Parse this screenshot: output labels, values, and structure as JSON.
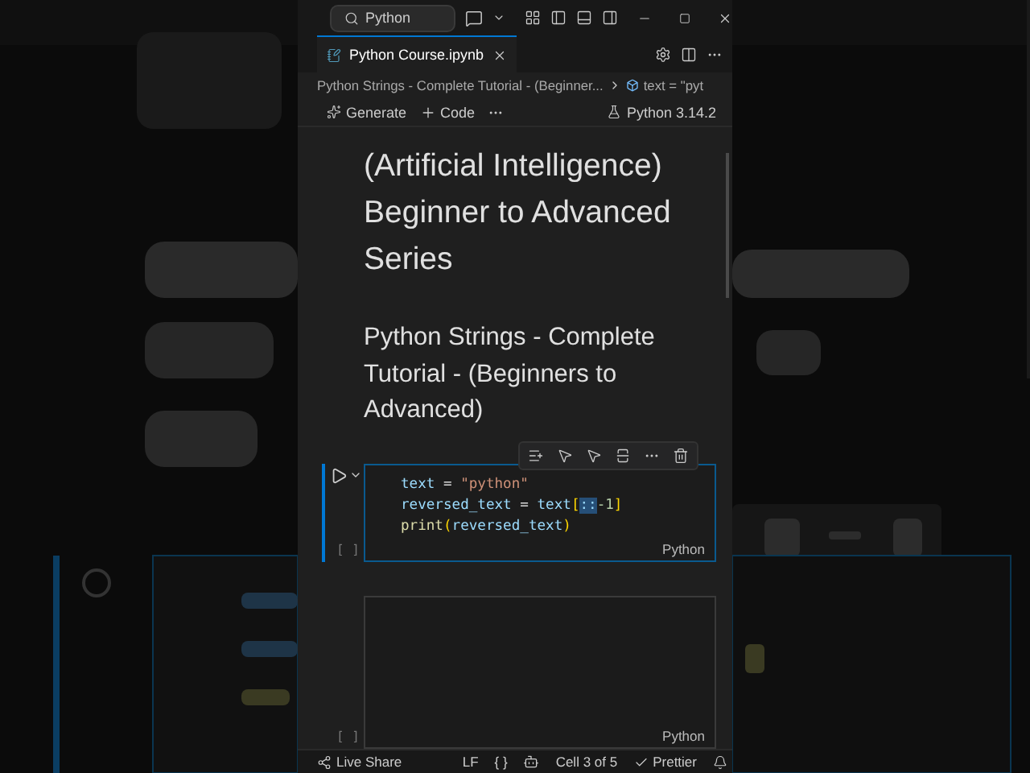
{
  "title_bar": {
    "search": "Python"
  },
  "tabs": [
    {
      "label": "Python Course.ipynb",
      "selected": true
    }
  ],
  "breadcrumb": [
    "Python Strings - Complete Tutorial - (Beginner...",
    "text = \"pyt"
  ],
  "notebook_toolbar": {
    "actions": [
      "Generate",
      "Code"
    ],
    "kernel": "Python 3.14.2"
  },
  "markdown": {
    "heading": "(Artificial Intelligence) Beginner to Advanced Series",
    "subheading": "Python Strings - Complete Tutorial - (Beginners to Advanced)"
  },
  "cells": [
    {
      "kind": "code",
      "selected": true,
      "execution": "[ ]",
      "language": "Python",
      "lines": [
        [
          {
            "t": "text",
            "kind": "var"
          },
          {
            "t": " = ",
            "kind": "op"
          },
          {
            "t": "\"python\"",
            "kind": "str"
          }
        ],
        [
          {
            "t": "reversed_text",
            "kind": "var"
          },
          {
            "t": " = ",
            "kind": "op"
          },
          {
            "t": "text",
            "kind": "var"
          },
          {
            "t": "[",
            "kind": "brk"
          },
          {
            "t": "::",
            "kind": "sel"
          },
          {
            "t": "-1",
            "kind": "num"
          },
          {
            "t": "]",
            "kind": "brk"
          }
        ],
        [
          {
            "t": "print",
            "kind": "fn"
          },
          {
            "t": "(",
            "kind": "brk"
          },
          {
            "t": "reversed_text",
            "kind": "var"
          },
          {
            "t": ")",
            "kind": "brk"
          }
        ]
      ]
    },
    {
      "kind": "code",
      "selected": false,
      "execution": "[ ]",
      "language": "Python"
    }
  ],
  "status_bar": {
    "items": [
      "Live Share",
      "LF",
      "{ }",
      "Cell 3 of 5",
      "Prettier"
    ]
  }
}
